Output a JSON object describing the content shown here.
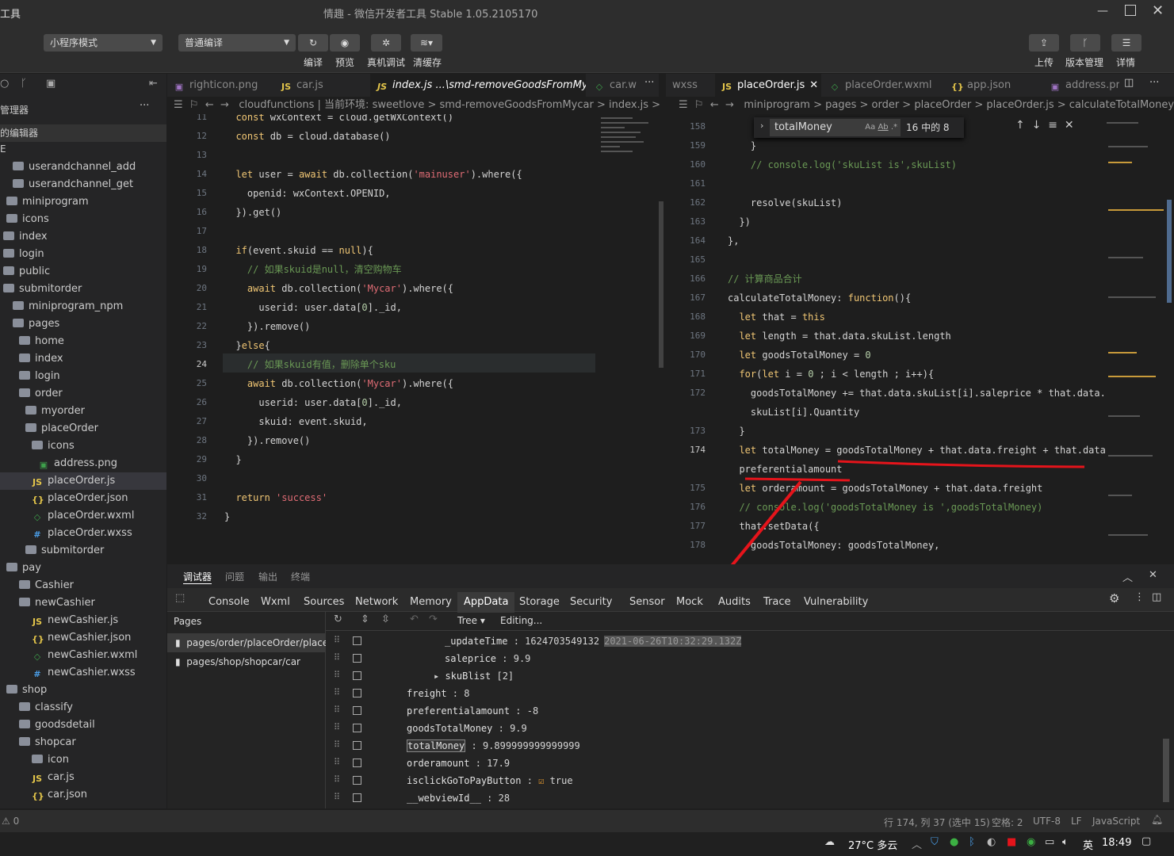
{
  "titlebar": {
    "app_left": "工具",
    "title": "情趣 - 微信开发者工具 Stable 1.05.2105170"
  },
  "toolbar": {
    "mode_select": "小程序模式",
    "compile_select": "普通编译",
    "btn_compile": "编译",
    "btn_preview": "预览",
    "btn_realdebug": "真机调试",
    "btn_clearcache": "清缓存",
    "btn_upload": "上传",
    "btn_version": "版本管理",
    "btn_detail": "详情"
  },
  "sidebar": {
    "header1": "管理器",
    "header2": "的编辑器",
    "header3": "E",
    "items": [
      {
        "label": "userandchannel_add",
        "type": "folder"
      },
      {
        "label": "userandchannel_get",
        "type": "folder"
      },
      {
        "label": "miniprogram",
        "type": "folder"
      },
      {
        "label": "icons",
        "type": "folder"
      },
      {
        "label": "index",
        "type": "folder"
      },
      {
        "label": "login",
        "type": "folder"
      },
      {
        "label": "public",
        "type": "folder"
      },
      {
        "label": "submitorder",
        "type": "folder"
      },
      {
        "label": "miniprogram_npm",
        "type": "folder"
      },
      {
        "label": "pages",
        "type": "folder"
      },
      {
        "label": "home",
        "type": "folder"
      },
      {
        "label": "index",
        "type": "folder"
      },
      {
        "label": "login",
        "type": "folder"
      },
      {
        "label": "order",
        "type": "folder"
      },
      {
        "label": "myorder",
        "type": "folder"
      },
      {
        "label": "placeOrder",
        "type": "folder"
      },
      {
        "label": "icons",
        "type": "folder"
      },
      {
        "label": "address.png",
        "type": "png"
      },
      {
        "label": "placeOrder.js",
        "type": "js"
      },
      {
        "label": "placeOrder.json",
        "type": "json"
      },
      {
        "label": "placeOrder.wxml",
        "type": "wxml"
      },
      {
        "label": "placeOrder.wxss",
        "type": "wxss"
      },
      {
        "label": "submitorder",
        "type": "folder"
      },
      {
        "label": "pay",
        "type": "folder"
      },
      {
        "label": "Cashier",
        "type": "folder"
      },
      {
        "label": "newCashier",
        "type": "folder"
      },
      {
        "label": "newCashier.js",
        "type": "js"
      },
      {
        "label": "newCashier.json",
        "type": "json"
      },
      {
        "label": "newCashier.wxml",
        "type": "wxml"
      },
      {
        "label": "newCashier.wxss",
        "type": "wxss"
      },
      {
        "label": "shop",
        "type": "folder"
      },
      {
        "label": "classify",
        "type": "folder"
      },
      {
        "label": "goodsdetail",
        "type": "folder"
      },
      {
        "label": "shopcar",
        "type": "folder"
      },
      {
        "label": "icon",
        "type": "folder"
      },
      {
        "label": "car.js",
        "type": "js"
      },
      {
        "label": "car.json",
        "type": "json"
      }
    ]
  },
  "editor_left": {
    "tabs": [
      "righticon.png",
      "car.js",
      "index.js ...\\smd-removeGoodsFromMycar",
      "car.w"
    ],
    "breadcrumb": "cloudfunctions | 当前环境: sweetlove > smd-removeGoodsFromMycar > index.js >",
    "lines": [
      {
        "n": "11",
        "t": "  const wxContext = cloud.getWXContext()"
      },
      {
        "n": "12",
        "t": "  const db = cloud.database()"
      },
      {
        "n": "13",
        "t": ""
      },
      {
        "n": "14",
        "t": "  let user = await db.collection('mainuser').where({"
      },
      {
        "n": "15",
        "t": "    openid: wxContext.OPENID,"
      },
      {
        "n": "16",
        "t": "  }).get()"
      },
      {
        "n": "17",
        "t": ""
      },
      {
        "n": "18",
        "t": "  if(event.skuid == null){"
      },
      {
        "n": "19",
        "t": "    // 如果skuid是null，清空购物车"
      },
      {
        "n": "20",
        "t": "    await db.collection('Mycar').where({"
      },
      {
        "n": "21",
        "t": "      userid: user.data[0]._id,"
      },
      {
        "n": "22",
        "t": "    }).remove()"
      },
      {
        "n": "23",
        "t": "  }else{"
      },
      {
        "n": "24",
        "t": "    // 如果skuid有值，删除单个sku"
      },
      {
        "n": "25",
        "t": "    await db.collection('Mycar').where({"
      },
      {
        "n": "26",
        "t": "      userid: user.data[0]._id,"
      },
      {
        "n": "27",
        "t": "      skuid: event.skuid,"
      },
      {
        "n": "28",
        "t": "    }).remove()"
      },
      {
        "n": "29",
        "t": "  }"
      },
      {
        "n": "30",
        "t": ""
      },
      {
        "n": "31",
        "t": "  return 'success'"
      },
      {
        "n": "32",
        "t": "}"
      }
    ]
  },
  "editor_right": {
    "tabs": [
      "wxss",
      "placeOrder.js",
      "placeOrder.wxml",
      "app.json",
      "address.pr"
    ],
    "breadcrumb": "miniprogram > pages > order > placeOrder > placeOrder.js > calculateTotalMoney",
    "find": {
      "query": "totalMoney",
      "result": "16 中的 8"
    },
    "lines": [
      {
        "n": "158",
        "t": ""
      },
      {
        "n": "159",
        "t": "    }"
      },
      {
        "n": "160",
        "t": "    // console.log('skuList is',skuList)"
      },
      {
        "n": "161",
        "t": ""
      },
      {
        "n": "162",
        "t": "    resolve(skuList)"
      },
      {
        "n": "163",
        "t": "  })"
      },
      {
        "n": "164",
        "t": "},"
      },
      {
        "n": "165",
        "t": ""
      },
      {
        "n": "166",
        "t": "// 计算商品合计"
      },
      {
        "n": "167",
        "t": "calculateTotalMoney: function(){"
      },
      {
        "n": "168",
        "t": "  let that = this"
      },
      {
        "n": "169",
        "t": "  let length = that.data.skuList.length"
      },
      {
        "n": "170",
        "t": "  let goodsTotalMoney = 0"
      },
      {
        "n": "171",
        "t": "  for(let i = 0 ; i < length ; i++){"
      },
      {
        "n": "172",
        "t": "    goodsTotalMoney += that.data.skuList[i].saleprice * that.data."
      },
      {
        "n": "",
        "t": "    skuList[i].Quantity"
      },
      {
        "n": "173",
        "t": "  }"
      },
      {
        "n": "174",
        "t": "  let totalMoney = goodsTotalMoney + that.data.freight + that.data."
      },
      {
        "n": "",
        "t": "  preferentialamount"
      },
      {
        "n": "175",
        "t": "  let orderamount = goodsTotalMoney + that.data.freight"
      },
      {
        "n": "176",
        "t": "  // console.log('goodsTotalMoney is ',goodsTotalMoney)"
      },
      {
        "n": "177",
        "t": "  that.setData({"
      },
      {
        "n": "178",
        "t": "    goodsTotalMoney: goodsTotalMoney,"
      }
    ]
  },
  "devtools": {
    "top_tabs": [
      "调试器",
      "问题",
      "输出",
      "终端"
    ],
    "tabs": [
      "Console",
      "Wxml",
      "Sources",
      "Network",
      "Memory",
      "AppData",
      "Storage",
      "Security",
      "Sensor",
      "Mock",
      "Audits",
      "Trace",
      "Vulnerability"
    ],
    "pages_header": "Pages",
    "pages": [
      "pages/order/placeOrder/place...",
      "pages/shop/shopcar/car"
    ],
    "view_mode": "Tree",
    "status": "Editing...",
    "props": [
      {
        "key": "_updateTime",
        "val": "1624703549132",
        "extra": "2021-06-26T10:32:29.132Z",
        "indent": 2
      },
      {
        "key": "saleprice",
        "val": "9.9",
        "indent": 2
      },
      {
        "key": "skuBlist",
        "val": "[2]",
        "indent": 1,
        "expand": true
      },
      {
        "key": "freight",
        "val": "8",
        "indent": 0
      },
      {
        "key": "preferentialamount",
        "val": "-8",
        "indent": 0
      },
      {
        "key": "goodsTotalMoney",
        "val": "9.9",
        "indent": 0
      },
      {
        "key": "totalMoney",
        "val": "9.899999999999999",
        "indent": 0
      },
      {
        "key": "orderamount",
        "val": "17.9",
        "indent": 0
      },
      {
        "key": "isclickGoToPayButton",
        "val": "true",
        "indent": 0,
        "checkbox": true
      },
      {
        "key": "__webviewId__",
        "val": "28",
        "indent": 0
      }
    ]
  },
  "statusbar": {
    "errors": "0",
    "position": "行 174, 列 37 (选中 15)",
    "spaces": "空格: 2",
    "encoding": "UTF-8",
    "eol": "LF",
    "language": "JavaScript"
  },
  "taskbar": {
    "weather": "27°C 多云",
    "ime": "英",
    "time": "18:49"
  },
  "colors": {
    "annotation_red": "#e5141b",
    "accent_blue": "#0e639c"
  }
}
